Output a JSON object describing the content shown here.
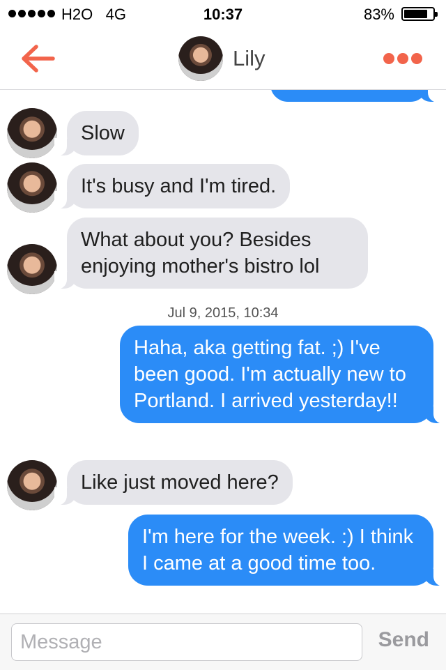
{
  "status_bar": {
    "carrier": "H2O",
    "network": "4G",
    "time": "10:37",
    "battery": "83%",
    "battery_level": 0.83
  },
  "header": {
    "contact_name": "Lily",
    "accent_color": "#f2644b"
  },
  "messages": [
    {
      "from": "them",
      "text": "Slow"
    },
    {
      "from": "them",
      "text": "It's busy and I'm tired."
    },
    {
      "from": "them",
      "text": "What about you? Besides enjoying mother's bistro lol"
    },
    {
      "from": "me",
      "text": "Haha, aka getting fat. ;) I've been good. I'm actually new to Portland. I arrived yesterday!!"
    },
    {
      "from": "them",
      "text": "Like just moved here?"
    },
    {
      "from": "me",
      "text": "I'm here for the week. :) I think I came at a good time too."
    }
  ],
  "timestamp": "Jul 9, 2015, 10:34",
  "composer": {
    "placeholder": "Message",
    "send_label": "Send"
  },
  "colors": {
    "outgoing_bubble": "#2b8cf7",
    "incoming_bubble": "#e5e5ea"
  }
}
